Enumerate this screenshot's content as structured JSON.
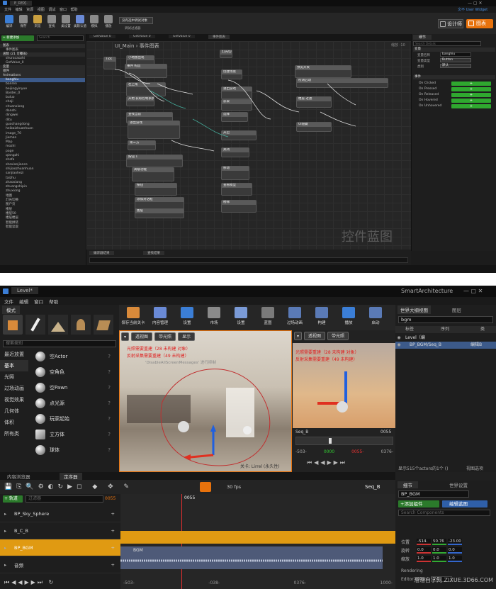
{
  "top": {
    "title": "E_RE的·",
    "user_widget": "文不 User Widget",
    "menu": [
      "文件",
      "编辑",
      "资源",
      "视图",
      "调试",
      "窗口",
      "帮助"
    ],
    "toolbar": [
      "编译",
      "保存",
      "浏览",
      "查找",
      "类设置",
      "类默认值",
      "模拟",
      "播放"
    ],
    "debug_filter": "没有选中调试对象",
    "debug_filter_sub": "调试过滤器",
    "designer_tab": "设计师",
    "graph_tab": "图表",
    "doc_tabs": [
      "GetValue 0",
      "GetValue 0",
      "GetValue 0",
      "事件图表"
    ],
    "add_new": "+ 新建添加",
    "search": "Search",
    "my_blueprint": {
      "groups": [
        "图表",
        "事件图表",
        "函数 (21 可覆盖)",
        "变量",
        "组件",
        "Animations"
      ],
      "functions": [
        "shuracaozhi",
        "GetValue_0"
      ],
      "animations": [
        "banghiu",
        "banren",
        "beijingyinyue",
        "Border_0",
        "buluo",
        "chaji",
        "chuanxiong",
        "danshi",
        "dingwei",
        "ditu",
        "guochangdong",
        "heibaizhuanhuan",
        "image_70",
        "Jieman",
        "Map",
        "mozhi",
        "page",
        "qiangzhi",
        "shafa",
        "shexianjiance",
        "shijiaozhuanhuan",
        "sanjiaohezi",
        "taizhu",
        "zhaoxiang",
        "zhuangshipin",
        "zhuxiong",
        "地图",
        "灯光切换",
        "图户页",
        "楼层",
        "楼层50",
        "楼层楼层",
        "智能拼装",
        "智能读取"
      ]
    },
    "graph_title": "UI_Main › 事件图表",
    "zoom_label": "缩放 -10",
    "watermark": "控件蓝图",
    "bottom_tabs": [
      "编译器结果",
      "查找结果"
    ],
    "details": {
      "tab": "细节",
      "search": "Search Details",
      "sec_var": "变量",
      "var_name_label": "变量名称",
      "var_name": "banghiu",
      "var_type_label": "变量类型",
      "var_type": "Button",
      "var_cat_label": "类别",
      "var_cat": "默认",
      "sec_events": "事件",
      "events": [
        "On Clicked",
        "On Pressed",
        "On Released",
        "On Hovered",
        "On Unhovered"
      ]
    },
    "nodes": [
      "Tick",
      "小地图出现",
      "事件 构造",
      "左上角",
      "开始 获取控制系统",
      "查找当前",
      "进出游戏",
      "第三方",
      "按钮 1",
      "高级功能",
      "按钮",
      "添加对话框",
      "图层",
      "灯光切换",
      "创建场景",
      "进出游戏",
      "获取",
      "选择",
      "开启",
      "关闭",
      "移动",
      "查看模型",
      "楼梯",
      "预览开关",
      "检测启动",
      "楼层 过滤",
      "UI隐藏"
    ]
  },
  "bottom": {
    "title": "Level*",
    "app": "SmartArchitecture",
    "menu": [
      "文件",
      "编辑",
      "窗口",
      "帮助"
    ],
    "modes_tab": "模式",
    "search_classes": "搜索类别",
    "categories": [
      "最近放置",
      "基本",
      "光照",
      "过场动画",
      "视觉效果",
      "几何体",
      "体积",
      "所有类"
    ],
    "assets": [
      "空Actor",
      "空角色",
      "空Pawn",
      "点光源",
      "玩家起始",
      "立方体",
      "球体"
    ],
    "toolbar": [
      "保存当前关卡",
      "内容管理",
      "设置",
      "市场",
      "设置",
      "蓝图",
      "过场动画",
      "构建",
      "播放",
      "启动"
    ],
    "vp1_btns": [
      "透视图",
      "带光照",
      "显示"
    ],
    "vp2_btns": [
      "透视图",
      "带光照"
    ],
    "vp_msg1": "光照需要重建（28 未构建 对象）",
    "vp_msg2": "反射采集需要重建（49 未构建）",
    "vp_msg3": "'DisableAllScreenMessages' 进行抑制",
    "level_label": "关卡: Lirrel (永久性)",
    "seq_name": "Seq_B",
    "seq_time": "0055",
    "seq_vals": [
      "-503-",
      "0000",
      "0055-",
      "0376-"
    ],
    "outliner_tab": "世界大纲视图",
    "layers_tab": "图层",
    "outliner_search": "bgm",
    "col_label": "标签",
    "col_seq": "序列",
    "col_type": "类",
    "outliner_rows": [
      {
        "label": "Level（编",
        "seq": "",
        "type": ""
      },
      {
        "label": "BP_BGM/Seq_B",
        "seq": "",
        "type": "编辑B"
      }
    ],
    "actor_count": "显示515个actors的1个 ()",
    "view_options": "视图选项",
    "content_tab": "内容浏览器",
    "sequencer_tab": "定序器",
    "fps": "30 fps",
    "add_track": "+ 轨道",
    "filter": "过滤器",
    "frame": "0055",
    "tracks": [
      "BP_Sky_Sphere",
      "B_C_B",
      "BP_BGM",
      "音频"
    ],
    "audio_clip": "BGM",
    "time_marks": [
      "-503-",
      "-038-",
      "0376-",
      "1000-"
    ],
    "details_tab": "细节",
    "world_settings_tab": "世界设置",
    "selected_actor": "BP_BGM",
    "add_component": "+添加组件",
    "edit_blueprint": "编辑蓝图",
    "search_components": "Search Components",
    "transform": [
      {
        "label": "位置",
        "v": [
          "-514.",
          "50.76",
          "-23.00"
        ]
      },
      {
        "label": "旋转",
        "v": [
          "0.0",
          "0.0",
          "0.0"
        ]
      },
      {
        "label": "缩放",
        "v": [
          "1.0",
          "1.0",
          "1.0"
        ]
      }
    ],
    "rendering": "Rendering",
    "editor_billboard": "Editor Billbo",
    "billboard_val": "1.0",
    "watermark": "溜溜自学网 ZIXUE.3D66.COM"
  }
}
